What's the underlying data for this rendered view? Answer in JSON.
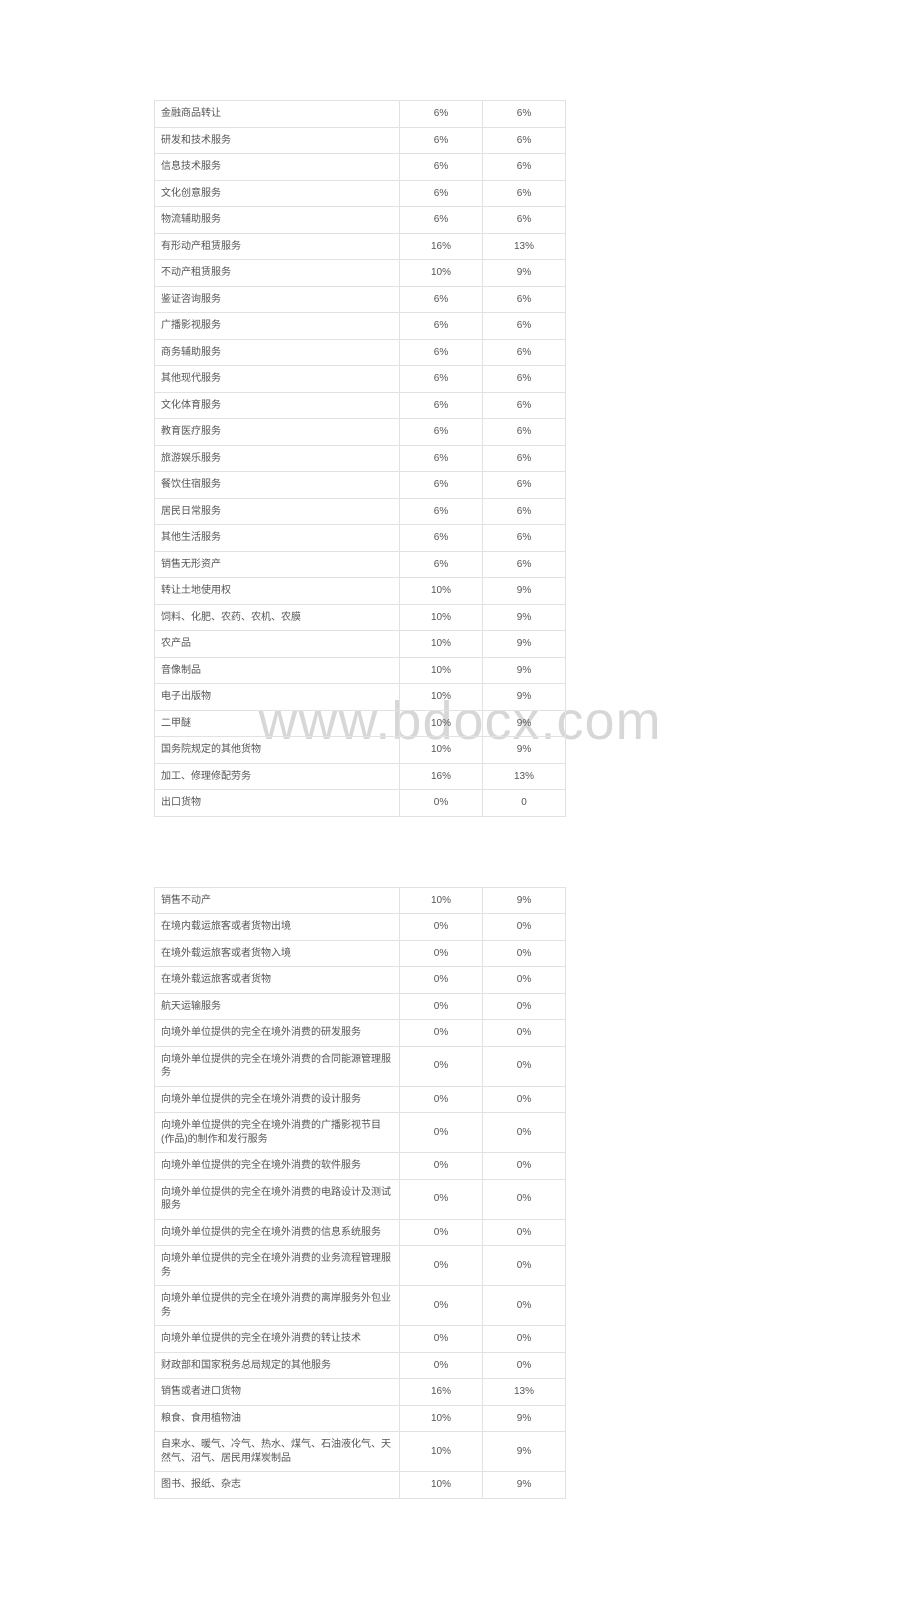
{
  "watermark": "www.bdocx.com",
  "table1": [
    {
      "name": "金融商品转让",
      "c1": "6%",
      "c2": "6%"
    },
    {
      "name": "研发和技术服务",
      "c1": "6%",
      "c2": "6%"
    },
    {
      "name": "信息技术服务",
      "c1": "6%",
      "c2": "6%"
    },
    {
      "name": "文化创意服务",
      "c1": "6%",
      "c2": "6%"
    },
    {
      "name": "物流辅助服务",
      "c1": "6%",
      "c2": "6%"
    },
    {
      "name": "有形动产租赁服务",
      "c1": "16%",
      "c2": "13%"
    },
    {
      "name": "不动产租赁服务",
      "c1": "10%",
      "c2": "9%"
    },
    {
      "name": "鉴证咨询服务",
      "c1": "6%",
      "c2": "6%"
    },
    {
      "name": "广播影视服务",
      "c1": "6%",
      "c2": "6%"
    },
    {
      "name": "商务辅助服务",
      "c1": "6%",
      "c2": "6%"
    },
    {
      "name": "其他现代服务",
      "c1": "6%",
      "c2": "6%"
    },
    {
      "name": "文化体育服务",
      "c1": "6%",
      "c2": "6%"
    },
    {
      "name": "教育医疗服务",
      "c1": "6%",
      "c2": "6%"
    },
    {
      "name": "旅游娱乐服务",
      "c1": "6%",
      "c2": "6%"
    },
    {
      "name": "餐饮住宿服务",
      "c1": "6%",
      "c2": "6%"
    },
    {
      "name": "居民日常服务",
      "c1": "6%",
      "c2": "6%"
    },
    {
      "name": "其他生活服务",
      "c1": "6%",
      "c2": "6%"
    },
    {
      "name": "销售无形资产",
      "c1": "6%",
      "c2": "6%"
    },
    {
      "name": "转让土地使用权",
      "c1": "10%",
      "c2": "9%"
    },
    {
      "name": "饲料、化肥、农药、农机、农膜",
      "c1": "10%",
      "c2": "9%"
    },
    {
      "name": "农产品",
      "c1": "10%",
      "c2": "9%"
    },
    {
      "name": "音像制品",
      "c1": "10%",
      "c2": "9%"
    },
    {
      "name": "电子出版物",
      "c1": "10%",
      "c2": "9%"
    },
    {
      "name": "二甲醚",
      "c1": "10%",
      "c2": "9%"
    },
    {
      "name": "国务院规定的其他货物",
      "c1": "10%",
      "c2": "9%"
    },
    {
      "name": "加工、修理修配劳务",
      "c1": "16%",
      "c2": "13%"
    },
    {
      "name": "出口货物",
      "c1": "0%",
      "c2": "0"
    }
  ],
  "table2": [
    {
      "name": "销售不动产",
      "c1": "10%",
      "c2": "9%"
    },
    {
      "name": "在境内载运旅客或者货物出境",
      "c1": "0%",
      "c2": "0%"
    },
    {
      "name": "在境外载运旅客或者货物入境",
      "c1": "0%",
      "c2": "0%"
    },
    {
      "name": "在境外载运旅客或者货物",
      "c1": "0%",
      "c2": "0%"
    },
    {
      "name": "航天运输服务",
      "c1": "0%",
      "c2": "0%"
    },
    {
      "name": "向境外单位提供的完全在境外消费的研发服务",
      "c1": "0%",
      "c2": "0%"
    },
    {
      "name": "向境外单位提供的完全在境外消费的合同能源管理服务",
      "c1": "0%",
      "c2": "0%"
    },
    {
      "name": "向境外单位提供的完全在境外消费的设计服务",
      "c1": "0%",
      "c2": "0%"
    },
    {
      "name": "向境外单位提供的完全在境外消费的广播影视节目(作品)的制作和发行服务",
      "c1": "0%",
      "c2": "0%"
    },
    {
      "name": "向境外单位提供的完全在境外消费的软件服务",
      "c1": "0%",
      "c2": "0%"
    },
    {
      "name": "向境外单位提供的完全在境外消费的电路设计及测试服务",
      "c1": "0%",
      "c2": "0%"
    },
    {
      "name": "向境外单位提供的完全在境外消费的信息系统服务",
      "c1": "0%",
      "c2": "0%"
    },
    {
      "name": "向境外单位提供的完全在境外消费的业务流程管理服务",
      "c1": "0%",
      "c2": "0%"
    },
    {
      "name": "向境外单位提供的完全在境外消费的离岸服务外包业务",
      "c1": "0%",
      "c2": "0%"
    },
    {
      "name": "向境外单位提供的完全在境外消费的转让技术",
      "c1": "0%",
      "c2": "0%"
    },
    {
      "name": "财政部和国家税务总局规定的其他服务",
      "c1": "0%",
      "c2": "0%"
    },
    {
      "name": "销售或者进口货物",
      "c1": "16%",
      "c2": "13%"
    },
    {
      "name": "粮食、食用植物油",
      "c1": "10%",
      "c2": "9%"
    },
    {
      "name": "自来水、暖气、冷气、热水、煤气、石油液化气、天然气、沼气、居民用煤炭制品",
      "c1": "10%",
      "c2": "9%"
    },
    {
      "name": "图书、报纸、杂志",
      "c1": "10%",
      "c2": "9%"
    }
  ]
}
